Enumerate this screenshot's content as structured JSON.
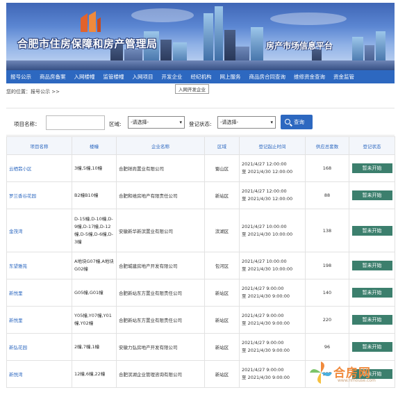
{
  "header": {
    "site_title": "合肥市住房保障和房产管理局",
    "platform_title": "房产市场信息平台"
  },
  "nav": {
    "items": [
      {
        "label": "报号公示"
      },
      {
        "label": "商品房备案"
      },
      {
        "label": "入网楼幢"
      },
      {
        "label": "监管楼幢"
      },
      {
        "label": "入网项目"
      },
      {
        "label": "开发企业"
      },
      {
        "label": "经纪机构"
      },
      {
        "label": "网上服务"
      },
      {
        "label": "商品房合同查询"
      },
      {
        "label": "维修资金查询"
      },
      {
        "label": "资金监管"
      }
    ],
    "tooltip": "入网开发企业"
  },
  "breadcrumb": "您的位置：报号公示 >>",
  "filter": {
    "project_label": "项目名称：",
    "project_value": "",
    "area_label": "区域:",
    "area_selected": "-请选择-",
    "status_label": "登记状态:",
    "status_selected": "-请选择-",
    "query_label": "查询"
  },
  "table": {
    "headers": [
      "项目名称",
      "楼幢",
      "企业名称",
      "区域",
      "登记起止时间",
      "供应总套数",
      "登记状态"
    ],
    "rows": [
      {
        "name": "云栖翡小区",
        "buildings": "3幢,5幢,10幢",
        "enterprise": "合肥祥尚置业有限公司",
        "area": "蜀山区",
        "start": "2021/4/27 12:00:00",
        "end": "至  2021/4/30 12:00:00",
        "count": "168",
        "status": "暂未开始"
      },
      {
        "name": "罗兰香谷花园",
        "buildings": "B2幢B10幢",
        "enterprise": "合肥和维房地产有限责任公司",
        "area": "新站区",
        "start": "2021/4/27 12:00:00",
        "end": "至  2021/4/30 12:00:00",
        "count": "88",
        "status": "暂未开始"
      },
      {
        "name": "金茂湾",
        "buildings": "D-15幢,D-10幢,D-9幢,D-17幢,D-12幢,D-5幢,D-6幢,D-3幢",
        "enterprise": "安徽新华新滨置业有限公司",
        "area": "滨湖区",
        "start": "2021/4/27 10:00:00",
        "end": "至  2021/4/30 10:00:00",
        "count": "138",
        "status": "暂未开始"
      },
      {
        "name": "东望雅苑",
        "buildings": "A地块G07幢,A地块G02幢",
        "enterprise": "合肥城建房地产开发有限公司",
        "area": "包河区",
        "start": "2021/4/27 10:00:00",
        "end": "至  2021/4/30 10:00:00",
        "count": "198",
        "status": "暂未开始"
      },
      {
        "name": "新悦里",
        "buildings": "G05幢,G01幢",
        "enterprise": "合肥新站东方置业有限责任公司",
        "area": "新站区",
        "start": "2021/4/27 9:00:00",
        "end": "至  2021/4/30 9:00:00",
        "count": "140",
        "status": "暂未开始"
      },
      {
        "name": "新悦里",
        "buildings": "Y05幢,Y07幢,Y01幢,Y02幢",
        "enterprise": "合肥新站东方置业有限责任公司",
        "area": "新站区",
        "start": "2021/4/27 9:00:00",
        "end": "至  2021/4/30 9:00:00",
        "count": "220",
        "status": "暂未开始"
      },
      {
        "name": "新弘花园",
        "buildings": "2幢,7幢,1幢",
        "enterprise": "安徽力弘房地产开发有限公司",
        "area": "新站区",
        "start": "2021/4/27 9:00:00",
        "end": "至  2021/4/30 9:00:00",
        "count": "96",
        "status": "暂未开始"
      },
      {
        "name": "新悦湾",
        "buildings": "12幢,6幢,22幢",
        "enterprise": "合肥滨湖企业管理咨询有限公司",
        "area": "新站区",
        "start": "2021/4/27 9:00:00",
        "end": "至  2021/4/30 9:00:00",
        "count": "237",
        "status": "暂未开始"
      }
    ]
  },
  "watermark": {
    "text": "合房网",
    "url": "www.hfhouse.com"
  },
  "colors": {
    "nav": "#2d68c0",
    "status_button": "#3c7f6d",
    "link": "#2d68c0",
    "watermark": "#f08a3c"
  }
}
